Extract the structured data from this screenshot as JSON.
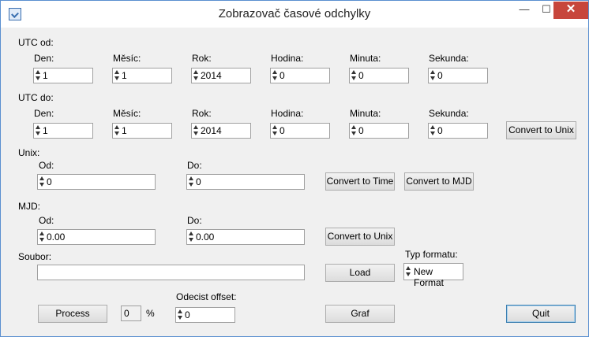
{
  "window": {
    "title": "Zobrazovač časové odchylky",
    "minimize": "—",
    "maximize": "☐",
    "close": "✕"
  },
  "utc_od": {
    "label": "UTC od:",
    "fields": [
      {
        "label": "Den:",
        "value": "1"
      },
      {
        "label": "Měsíc:",
        "value": "1"
      },
      {
        "label": "Rok:",
        "value": "2014"
      },
      {
        "label": "Hodina:",
        "value": "0"
      },
      {
        "label": "Minuta:",
        "value": "0"
      },
      {
        "label": "Sekunda:",
        "value": "0"
      }
    ]
  },
  "utc_do": {
    "label": "UTC do:",
    "fields": [
      {
        "label": "Den:",
        "value": "1"
      },
      {
        "label": "Měsíc:",
        "value": "1"
      },
      {
        "label": "Rok:",
        "value": "2014"
      },
      {
        "label": "Hodina:",
        "value": "0"
      },
      {
        "label": "Minuta:",
        "value": "0"
      },
      {
        "label": "Sekunda:",
        "value": "0"
      }
    ],
    "convert_button": "Convert to Unix"
  },
  "unix": {
    "label": "Unix:",
    "od_label": "Od:",
    "od_value": "0",
    "do_label": "Do:",
    "do_value": "0",
    "to_time_button": "Convert to Time",
    "to_mjd_button": "Convert to MJD"
  },
  "mjd": {
    "label": "MJD:",
    "od_label": "Od:",
    "od_value": "0.00",
    "do_label": "Do:",
    "do_value": "0.00",
    "convert_button": "Convert to Unix"
  },
  "soubor": {
    "label": "Soubor:",
    "value": "",
    "load_button": "Load",
    "format_label": "Typ formatu:",
    "format_value": "New Format"
  },
  "bottom": {
    "process_button": "Process",
    "progress_value": "0",
    "percent": "%",
    "offset_label": "Odecist offset:",
    "offset_value": "0",
    "graf_button": "Graf",
    "quit_button": "Quit"
  }
}
